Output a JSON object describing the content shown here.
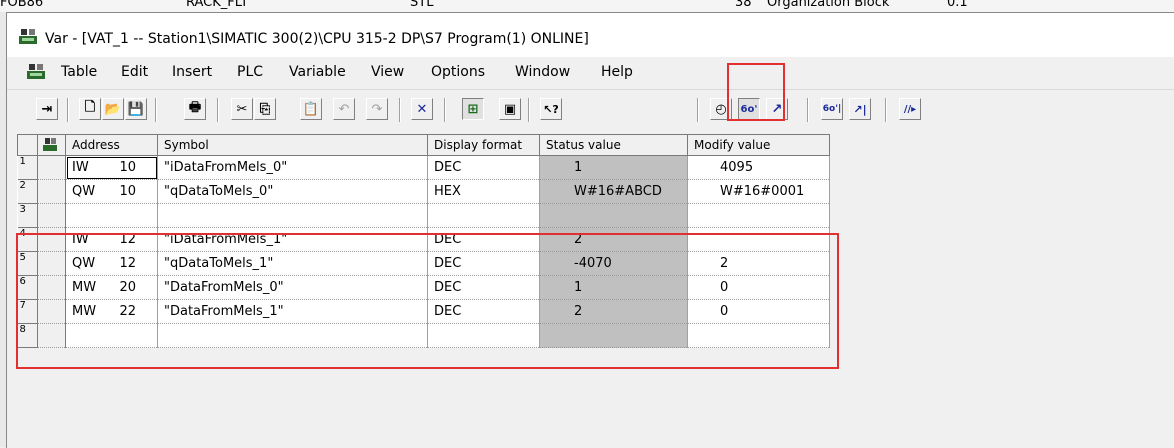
{
  "background_row": {
    "col1": "FOB86",
    "col2": "RACK_FLT",
    "col3": "STL",
    "col4": "38",
    "col5": "Organization Block",
    "col6": "0.1"
  },
  "window": {
    "title": "Var - [VAT_1 -- Station1\\SIMATIC 300(2)\\CPU 315-2 DP\\S7 Program(1)  ONLINE]"
  },
  "menu": [
    "Table",
    "Edit",
    "Insert",
    "PLC",
    "Variable",
    "View",
    "Options",
    "Window",
    "Help"
  ],
  "toolbar": {
    "buttons": [
      {
        "name": "pin-icon",
        "glyph": "⇥"
      },
      {
        "name": "new-document-icon",
        "glyph": "🗋"
      },
      {
        "name": "open-folder-icon",
        "glyph": "📂"
      },
      {
        "name": "save-icon",
        "glyph": "💾"
      },
      {
        "name": "print-icon",
        "glyph": "🖶"
      },
      {
        "name": "cut-icon",
        "glyph": "✂"
      },
      {
        "name": "copy-icon",
        "glyph": "⎘"
      },
      {
        "name": "paste-icon",
        "glyph": "📋"
      },
      {
        "name": "undo-icon",
        "glyph": "↶"
      },
      {
        "name": "redo-icon",
        "glyph": "↷"
      },
      {
        "name": "delete-icon",
        "glyph": "✕"
      },
      {
        "name": "online-connect-icon",
        "glyph": "⊞"
      },
      {
        "name": "plc-icon",
        "glyph": "▣"
      },
      {
        "name": "context-help-icon",
        "glyph": "↖?"
      },
      {
        "name": "trigger-icon",
        "glyph": "◴"
      },
      {
        "name": "monitor-variable-icon",
        "glyph": "6o'"
      },
      {
        "name": "modify-variable-icon",
        "glyph": "↗"
      },
      {
        "name": "update-monitor-values-icon",
        "glyph": "6o'|"
      },
      {
        "name": "activate-modify-values-icon",
        "glyph": "↗|"
      },
      {
        "name": "force-icon",
        "glyph": "//▸"
      }
    ]
  },
  "table": {
    "headers": {
      "address": "Address",
      "symbol": "Symbol",
      "display_format": "Display format",
      "status_value": "Status value",
      "modify_value": "Modify value"
    },
    "rows": [
      {
        "n": "1",
        "op": "IW",
        "num": "10",
        "symbol": "\"iDataFromMels_0\"",
        "format": "DEC",
        "status": "1",
        "modify": "4095"
      },
      {
        "n": "2",
        "op": "QW",
        "num": "10",
        "symbol": "\"qDataToMels_0\"",
        "format": "HEX",
        "status": "W#16#ABCD",
        "modify": "W#16#0001"
      },
      {
        "n": "3",
        "op": "",
        "num": "",
        "symbol": "",
        "format": "",
        "status": "",
        "modify": ""
      },
      {
        "n": "4",
        "op": "IW",
        "num": "12",
        "symbol": "\"iDataFromMels_1\"",
        "format": "DEC",
        "status": "2",
        "modify": ""
      },
      {
        "n": "5",
        "op": "QW",
        "num": "12",
        "symbol": "\"qDataToMels_1\"",
        "format": "DEC",
        "status": "-4070",
        "modify": "2"
      },
      {
        "n": "6",
        "op": "MW",
        "num": "20",
        "symbol": "\"DataFromMels_0\"",
        "format": "DEC",
        "status": "1",
        "modify": "0"
      },
      {
        "n": "7",
        "op": "MW",
        "num": "22",
        "symbol": "\"DataFromMels_1\"",
        "format": "DEC",
        "status": "2",
        "modify": "0"
      },
      {
        "n": "8",
        "op": "",
        "num": "",
        "symbol": "",
        "format": "",
        "status": "",
        "modify": ""
      }
    ]
  },
  "colors": {
    "highlight_box": "#e03030",
    "status_column": "#c0c0c0"
  }
}
